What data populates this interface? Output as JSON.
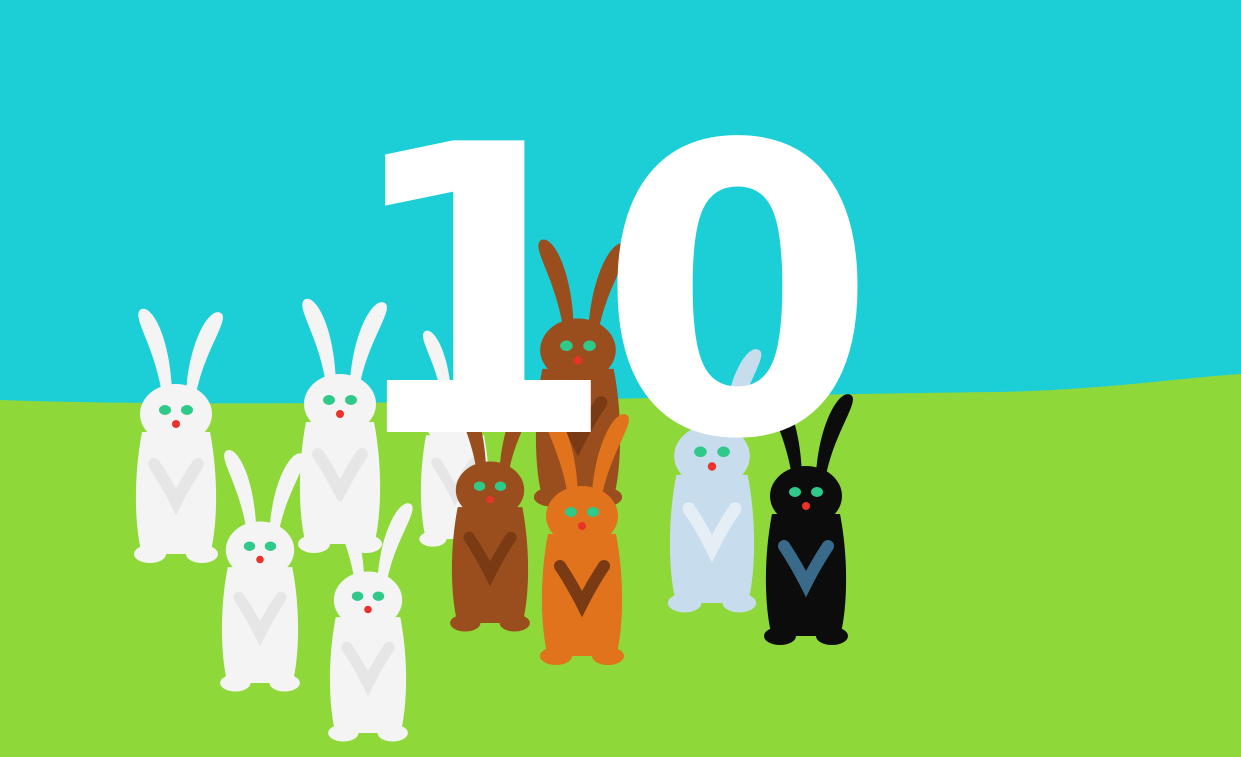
{
  "caption": "10",
  "colors": {
    "sky": "#1ccfd6",
    "grass": "#8fd83a",
    "number": "#ffffff"
  },
  "bunnies": [
    {
      "name": "white-bunny-1",
      "color": "#f4f4f4",
      "eyes": "#2fc98a"
    },
    {
      "name": "white-bunny-2",
      "color": "#f4f4f4",
      "eyes": "#2fc98a"
    },
    {
      "name": "white-bunny-3",
      "color": "#f4f4f4",
      "eyes": "#2fc98a"
    },
    {
      "name": "white-bunny-4",
      "color": "#f4f4f4",
      "eyes": "#2fc98a"
    },
    {
      "name": "white-bunny-5",
      "color": "#f4f4f4",
      "eyes": "#2fc98a"
    },
    {
      "name": "brown-bunny-small",
      "color": "#9a4e1e",
      "eyes": "#2fc98a"
    },
    {
      "name": "brown-bunny-tall",
      "color": "#9a4e1e",
      "eyes": "#2fc98a"
    },
    {
      "name": "orange-bunny",
      "color": "#e0731c",
      "eyes": "#2fc98a"
    },
    {
      "name": "light-blue-bunny",
      "color": "#c7dcec",
      "eyes": "#2fc98a"
    },
    {
      "name": "black-bunny",
      "color": "#0c0c0c",
      "eyes": "#2fc98a"
    }
  ]
}
